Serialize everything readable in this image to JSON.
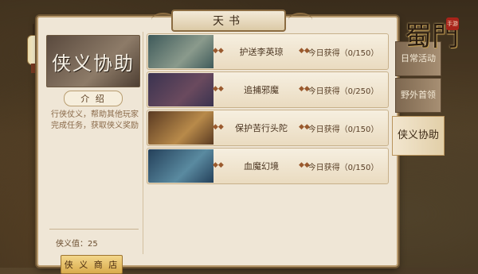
{
  "window": {
    "title": "天书"
  },
  "logo": {
    "text": "蜀門",
    "seal": "手游"
  },
  "left_panel": {
    "banner_title": "侠义协助",
    "intro_tab": "介 绍",
    "description": "行侠仗义，帮助其他玩家完成任务，获取侠义奖励",
    "value_text": "侠义值：25",
    "shop_button": "侠 义 商 店"
  },
  "tasks": [
    {
      "name": "护送李英琼",
      "count_text": "今日获得（0/150）",
      "thumb_colors": [
        "#3f5a5a",
        "#8a9a8c"
      ]
    },
    {
      "name": "追捕邪魔",
      "count_text": "今日获得（0/250）",
      "thumb_colors": [
        "#3a3350",
        "#6a4a5e"
      ]
    },
    {
      "name": "保护苦行头陀",
      "count_text": "今日获得（0/150）",
      "thumb_colors": [
        "#5a3a22",
        "#b88a4a"
      ]
    },
    {
      "name": "血魔幻境",
      "count_text": "今日获得（0/150）",
      "thumb_colors": [
        "#24405a",
        "#5a8aa0"
      ]
    }
  ],
  "right_tabs": [
    {
      "label": "日常活动",
      "active": false
    },
    {
      "label": "野外首领",
      "active": false
    },
    {
      "label": "侠义协助",
      "active": true
    }
  ],
  "icons": {
    "task_marker": "◆◆"
  }
}
